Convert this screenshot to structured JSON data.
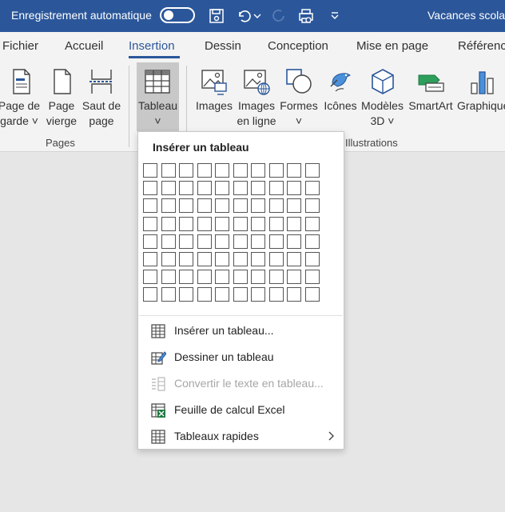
{
  "titlebar": {
    "autosave_label": "Enregistrement automatique",
    "doc_title": "Vacances scolai"
  },
  "tabs": [
    {
      "label": "Fichier"
    },
    {
      "label": "Accueil"
    },
    {
      "label": "Insertion"
    },
    {
      "label": "Dessin"
    },
    {
      "label": "Conception"
    },
    {
      "label": "Mise en page"
    },
    {
      "label": "Référenc"
    }
  ],
  "ribbon": {
    "pages_group": {
      "label": "Pages",
      "cover_page": {
        "line1": "Page de",
        "line2": "garde ˅"
      },
      "blank_page": {
        "line1": "Page",
        "line2": "vierge"
      },
      "page_break": {
        "line1": "Saut de",
        "line2": "page"
      }
    },
    "table_button": {
      "line1": "Tableau",
      "line2": "˅"
    },
    "illustrations_group": {
      "label": "Illustrations",
      "images": {
        "line1": "Images"
      },
      "online_images": {
        "line1": "Images",
        "line2": "en ligne"
      },
      "shapes": {
        "line1": "Formes",
        "line2": "˅"
      },
      "icons": {
        "line1": "Icônes"
      },
      "models_3d": {
        "line1": "Modèles",
        "line2": "3D ˅"
      },
      "smartart": {
        "line1": "SmartArt"
      },
      "chart": {
        "line1": "Graphique"
      }
    }
  },
  "dropdown": {
    "title": "Insérer un tableau",
    "grid": {
      "columns": 10,
      "rows": 8
    },
    "items": [
      {
        "label": "Insérer un tableau...",
        "icon": "table-grid-icon",
        "enabled": true
      },
      {
        "label": "Dessiner un tableau",
        "icon": "draw-table-icon",
        "enabled": true
      },
      {
        "label": "Convertir le texte en tableau...",
        "icon": "convert-text-table-icon",
        "enabled": false
      },
      {
        "label": "Feuille de calcul Excel",
        "icon": "excel-sheet-icon",
        "enabled": true
      },
      {
        "label": "Tableaux rapides",
        "icon": "quick-tables-icon",
        "enabled": true,
        "has_submenu": true
      }
    ]
  },
  "colors": {
    "titlebar_bg": "#2b579a",
    "ribbon_bg": "#f3f3f3",
    "document_bg": "#e6e6e6",
    "accent": "#2b579a"
  }
}
